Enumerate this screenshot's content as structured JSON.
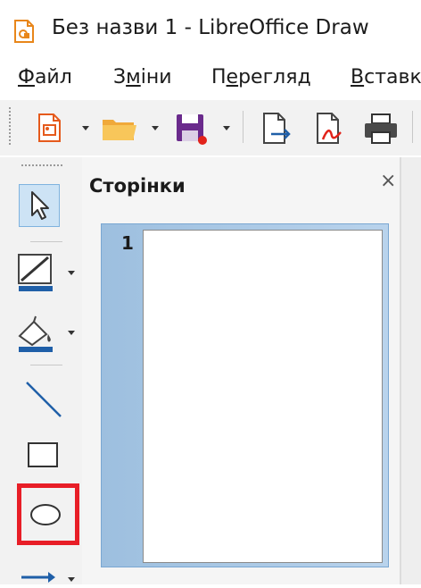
{
  "window": {
    "title": "Без назви 1 - LibreOffice Draw"
  },
  "menu": {
    "items": [
      {
        "label": "Файл",
        "underline_char": "Ф"
      },
      {
        "label": "Зміни",
        "underline_char": "м"
      },
      {
        "label": "Перегляд",
        "underline_char": "е"
      },
      {
        "label": "Вставк",
        "underline_char": "В"
      }
    ]
  },
  "toolbar": {
    "icons": [
      "new-drawing-icon",
      "open-folder-icon",
      "save-icon",
      "export-icon",
      "export-pdf-icon",
      "print-icon"
    ]
  },
  "toolbox": {
    "tools": [
      "select-icon",
      "line-color-icon",
      "fill-color-icon",
      "line-icon",
      "rectangle-icon",
      "ellipse-icon",
      "line-arrow-icon"
    ],
    "highlight_color": "#e81e27"
  },
  "pages_panel": {
    "title": "Сторінки",
    "close_glyph": "×",
    "pages": [
      {
        "number": "1"
      }
    ]
  },
  "colors": {
    "accent_blue": "#1f5fa8",
    "save_purple": "#6a2a8c",
    "selection_blue": "#cde3f5"
  }
}
